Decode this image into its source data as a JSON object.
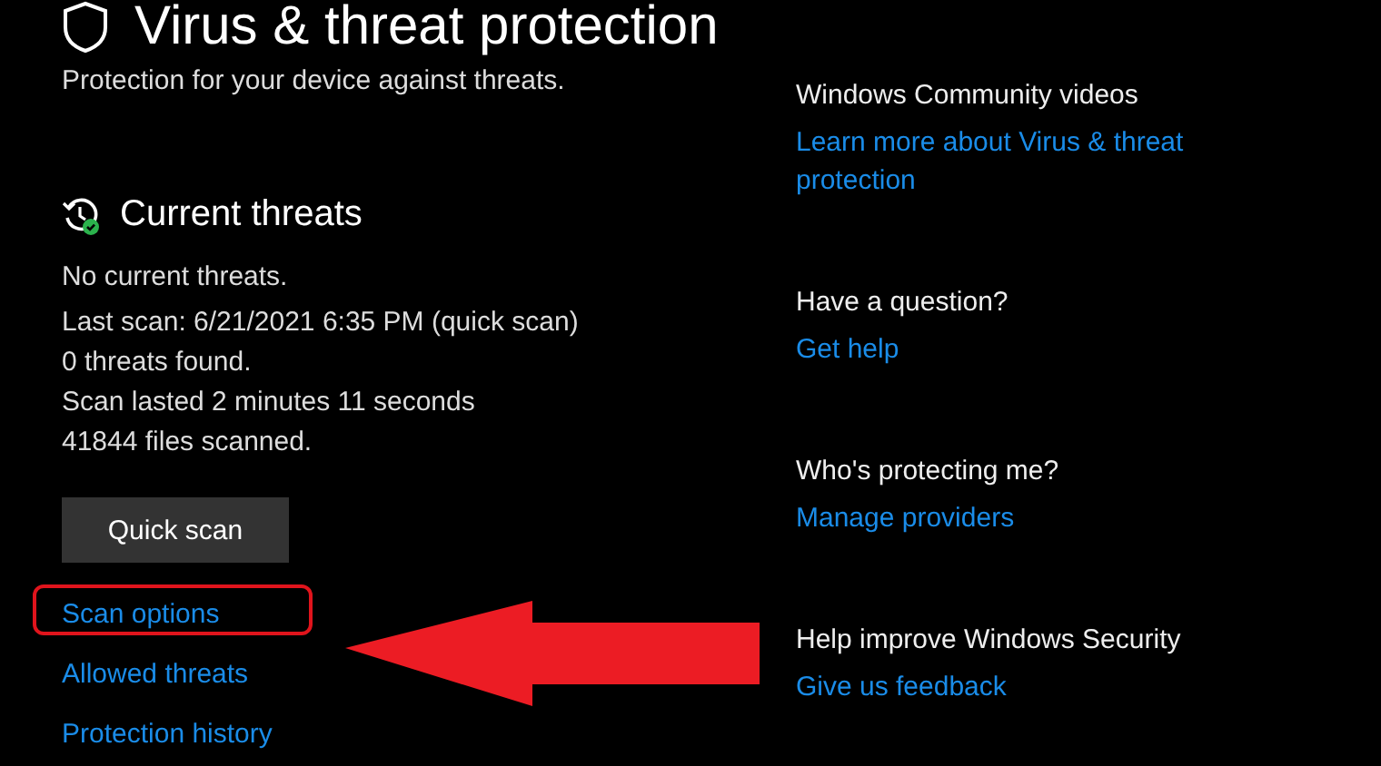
{
  "title": "Virus & threat protection",
  "subtitle": "Protection for your device against threats.",
  "current_threats": {
    "heading": "Current threats",
    "lines": [
      "No current threats.",
      "Last scan: 6/21/2021 6:35 PM (quick scan)",
      "0 threats found.",
      "Scan lasted 2 minutes 11 seconds",
      "41844 files scanned."
    ],
    "button": "Quick scan"
  },
  "links": [
    {
      "label": "Scan options",
      "highlighted": true
    },
    {
      "label": "Allowed threats",
      "highlighted": false
    },
    {
      "label": "Protection history",
      "highlighted": false
    }
  ],
  "side_sections": [
    {
      "heading": "Windows Community videos",
      "link": "Learn more about Virus & threat protection"
    },
    {
      "heading": "Have a question?",
      "link": "Get help"
    },
    {
      "heading": "Who's protecting me?",
      "link": "Manage providers"
    },
    {
      "heading": "Help improve Windows Security",
      "link": "Give us feedback"
    }
  ]
}
